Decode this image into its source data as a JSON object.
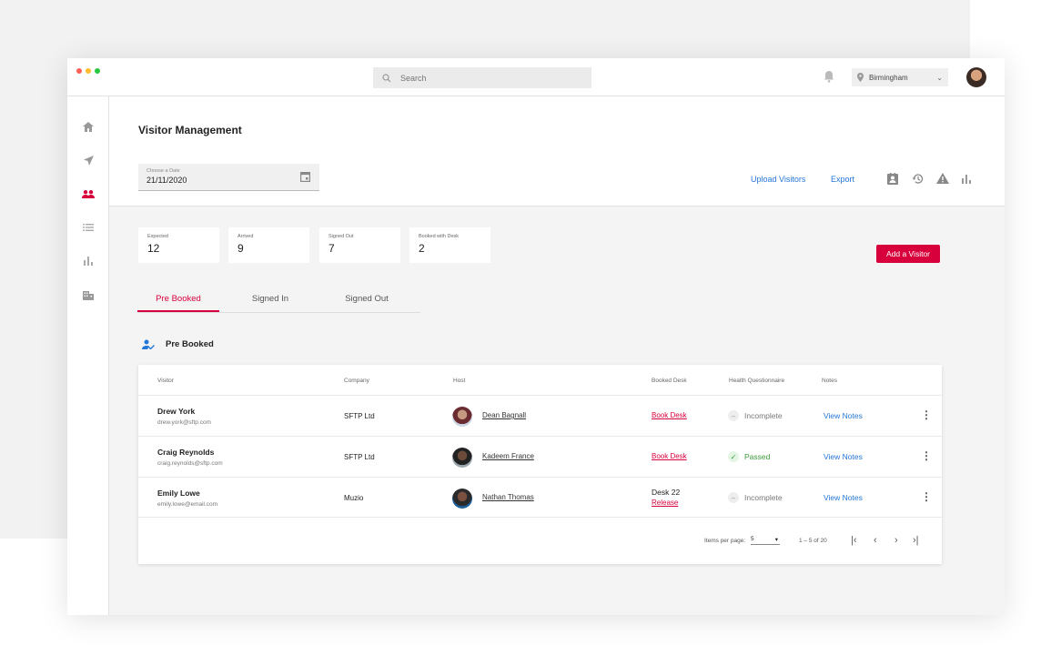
{
  "header": {
    "search_placeholder": "Search",
    "location": "Birmingham"
  },
  "page": {
    "title": "Visitor Management",
    "date_label": "Choose a Date",
    "date_value": "21/11/2020",
    "upload_label": "Upload Visitors",
    "export_label": "Export",
    "add_visitor_label": "Add a Visitor"
  },
  "stats": [
    {
      "label": "Expected",
      "value": "12"
    },
    {
      "label": "Arrived",
      "value": "9"
    },
    {
      "label": "Signed Out",
      "value": "7"
    },
    {
      "label": "Booked with Desk",
      "value": "2"
    }
  ],
  "tabs": [
    {
      "label": "Pre Booked"
    },
    {
      "label": "Signed In"
    },
    {
      "label": "Signed Out"
    }
  ],
  "section_title": "Pre Booked",
  "table": {
    "columns": [
      "Visitor",
      "Company",
      "Host",
      "Booked Desk",
      "Health Questionnaire",
      "Notes"
    ],
    "rows": [
      {
        "name": "Drew York",
        "email": "drew.york@sftp.com",
        "company": "SFTP Ltd",
        "host": "Dean Bagnall",
        "desk": "",
        "desk_action": "Book Desk",
        "health": "Incomplete",
        "notes": "View Notes"
      },
      {
        "name": "Craig Reynolds",
        "email": "craig.reynolds@sftp.com",
        "company": "SFTP Ltd",
        "host": "Kadeem France",
        "desk": "",
        "desk_action": "Book Desk",
        "health": "Passed",
        "notes": "View Notes"
      },
      {
        "name": "Emily Lowe",
        "email": "emily.lowe@email.com",
        "company": "Muzio",
        "host": "Nathan Thomas",
        "desk": "Desk 22",
        "desk_action": "Release",
        "health": "Incomplete",
        "notes": "View Notes"
      }
    ]
  },
  "pagination": {
    "items_per_page_label": "Items per page:",
    "items_per_page": "5",
    "range": "1 – 5 of 20"
  },
  "colors": {
    "accent": "#d8003c",
    "link": "#2476d9"
  }
}
